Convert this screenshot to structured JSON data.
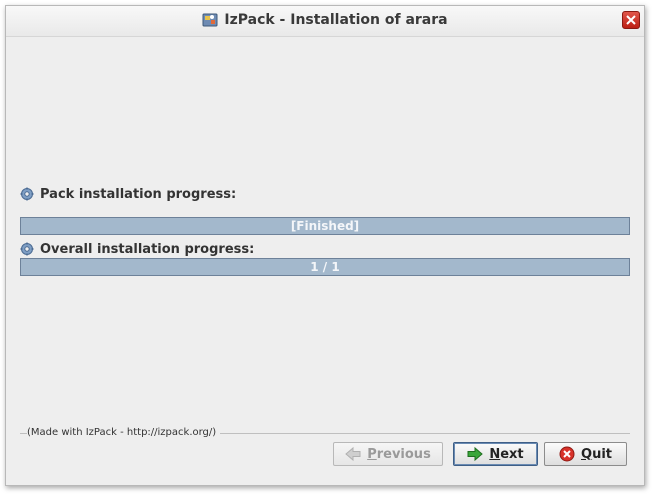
{
  "window": {
    "title": "IzPack - Installation of arara"
  },
  "pack_progress": {
    "label": "Pack installation progress:",
    "text": "[Finished]",
    "fraction": 1.0
  },
  "overall_progress": {
    "label": "Overall installation progress:",
    "text": "1 / 1",
    "fraction": 1.0
  },
  "footer": {
    "credit": "(Made with IzPack - http://izpack.org/)"
  },
  "buttons": {
    "previous": {
      "mnemonic": "P",
      "rest": "revious",
      "enabled": false
    },
    "next": {
      "mnemonic": "N",
      "rest": "ext",
      "enabled": true
    },
    "quit": {
      "mnemonic": "Q",
      "rest": "uit",
      "enabled": true
    }
  },
  "icons": {
    "app": "izpack-app-icon",
    "close": "close-icon",
    "section": "gear-icon",
    "previous": "arrow-left-icon",
    "next": "arrow-right-icon",
    "quit": "quit-x-icon"
  },
  "colors": {
    "progress_fill": "#a3b8cc",
    "progress_border": "#6d8199",
    "close_red": "#cc2b1f",
    "next_arrow_green": "#3aa63a"
  }
}
